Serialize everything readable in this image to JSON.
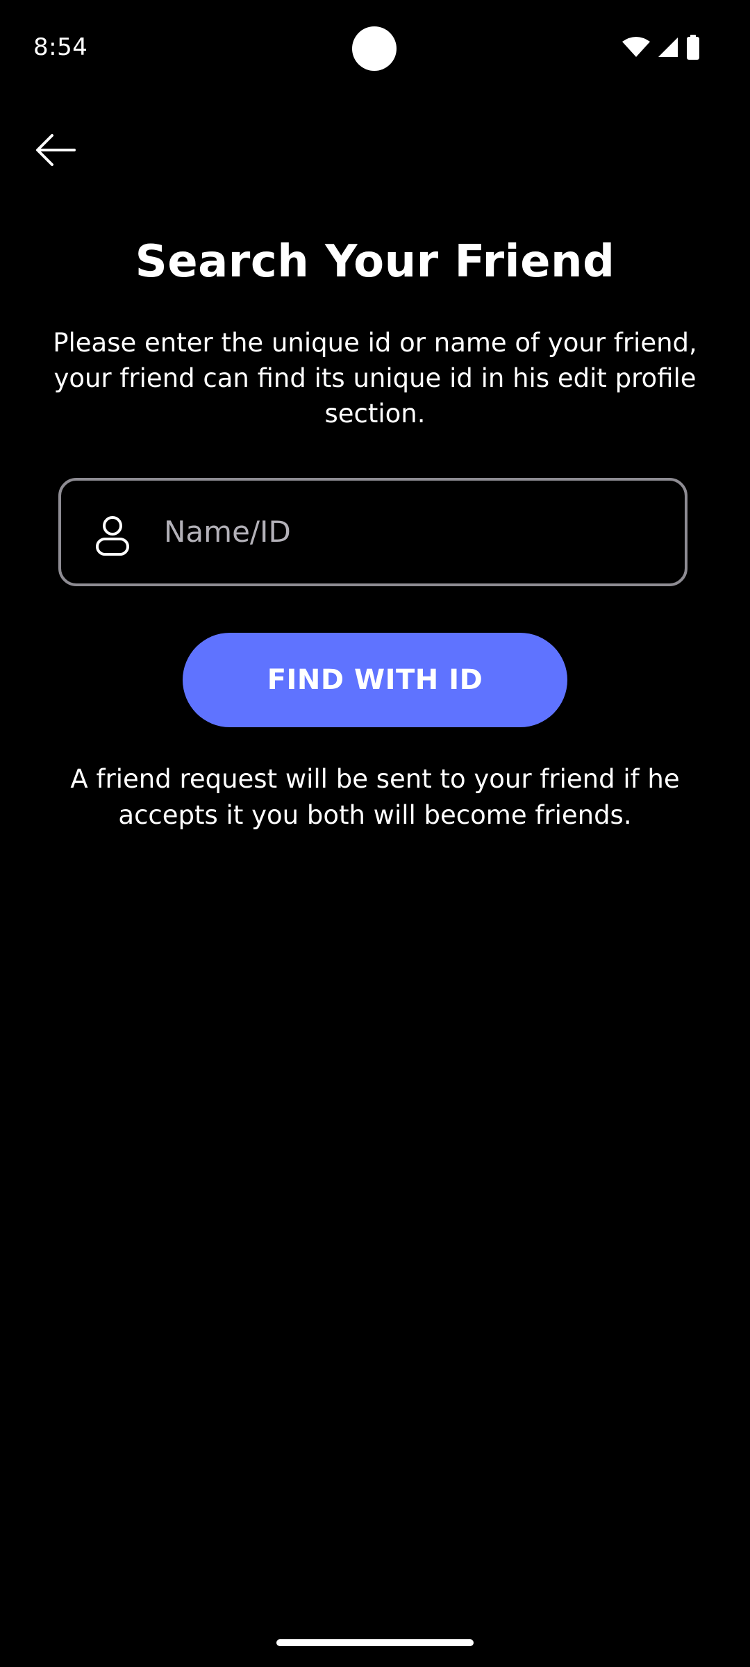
{
  "status_bar": {
    "time": "8:54",
    "icons": [
      "wifi-icon",
      "cellular-signal-icon",
      "battery-icon"
    ]
  },
  "header": {
    "back_icon": "arrow-left-icon"
  },
  "main": {
    "title": "Search Your Friend",
    "description": "Please enter the unique id or name of your friend, your friend can find its unique id in his edit profile section.",
    "search": {
      "icon": "person-icon",
      "placeholder": "Name/ID",
      "value": ""
    },
    "find_button_label": "FIND WITH ID",
    "footer_note": "A friend request will be sent to your friend if he accepts it you both will become friends."
  },
  "colors": {
    "background": "#000000",
    "accent": "#5f73ff",
    "field_border": "#8e8c93",
    "placeholder": "#b3b1b8",
    "text": "#ffffff"
  }
}
